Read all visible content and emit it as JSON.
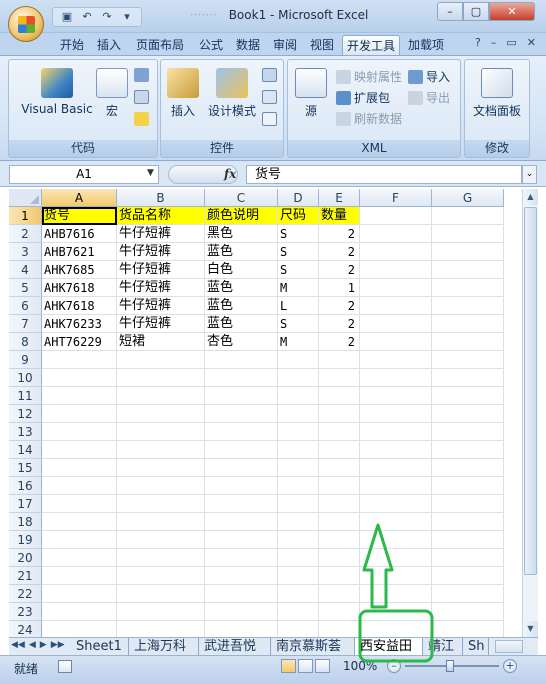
{
  "window": {
    "title": "Book1 - Microsoft Excel",
    "blurred_prefix": "·······"
  },
  "ribbon_tabs": [
    "开始",
    "插入",
    "页面布局",
    "公式",
    "数据",
    "审阅",
    "视图",
    "开发工具",
    "加载项"
  ],
  "active_tab": "开发工具",
  "ribbon": {
    "code": {
      "label": "代码",
      "visual_basic": "Visual Basic",
      "macro": "宏"
    },
    "controls": {
      "label": "控件",
      "insert": "插入",
      "design_mode": "设计模式"
    },
    "xml": {
      "label": "XML",
      "source": "源",
      "map_properties": "映射属性",
      "expansion_pack": "扩展包",
      "refresh_data": "刷新数据",
      "import": "导入",
      "export": "导出"
    },
    "modify": {
      "label": "修改",
      "document_panel": "文档面板"
    }
  },
  "formula_bar": {
    "name_box": "A1",
    "fx": "fx",
    "content": "货号"
  },
  "columns": [
    "A",
    "B",
    "C",
    "D",
    "E",
    "F",
    "G"
  ],
  "rows": [
    "1",
    "2",
    "3",
    "4",
    "5",
    "6",
    "7",
    "8",
    "9",
    "10",
    "11",
    "12",
    "13",
    "14",
    "15",
    "16",
    "17",
    "18",
    "19",
    "20",
    "21",
    "22",
    "23",
    "24"
  ],
  "table": {
    "headers": [
      "货号",
      "货品名称",
      "颜色说明",
      "尺码",
      "数量"
    ],
    "rows": [
      [
        "AHB7616",
        "牛仔短裤",
        "黑色",
        "S",
        "2"
      ],
      [
        "AHB7621",
        "牛仔短裤",
        "蓝色",
        "S",
        "2"
      ],
      [
        "AHK7685",
        "牛仔短裤",
        "白色",
        "S",
        "2"
      ],
      [
        "AHK7618",
        "牛仔短裤",
        "蓝色",
        "M",
        "1"
      ],
      [
        "AHK7618",
        "牛仔短裤",
        "蓝色",
        "L",
        "2"
      ],
      [
        "AHK76233",
        "牛仔短裤",
        "蓝色",
        "S",
        "2"
      ],
      [
        "AHT76229",
        "短裙",
        "杏色",
        "M",
        "2"
      ]
    ]
  },
  "sheet_tabs": [
    "Sheet1",
    "上海万科",
    "武进吾悦",
    "南京慕斯荟",
    "西安益田",
    "靖江",
    "Sh"
  ],
  "active_sheet": "西安益田",
  "status": {
    "ready": "就绪",
    "zoom": "100%"
  },
  "colors": {
    "header_fill": "#ffff00",
    "annotation": "#2db84a",
    "selection": "#f3c86d"
  }
}
